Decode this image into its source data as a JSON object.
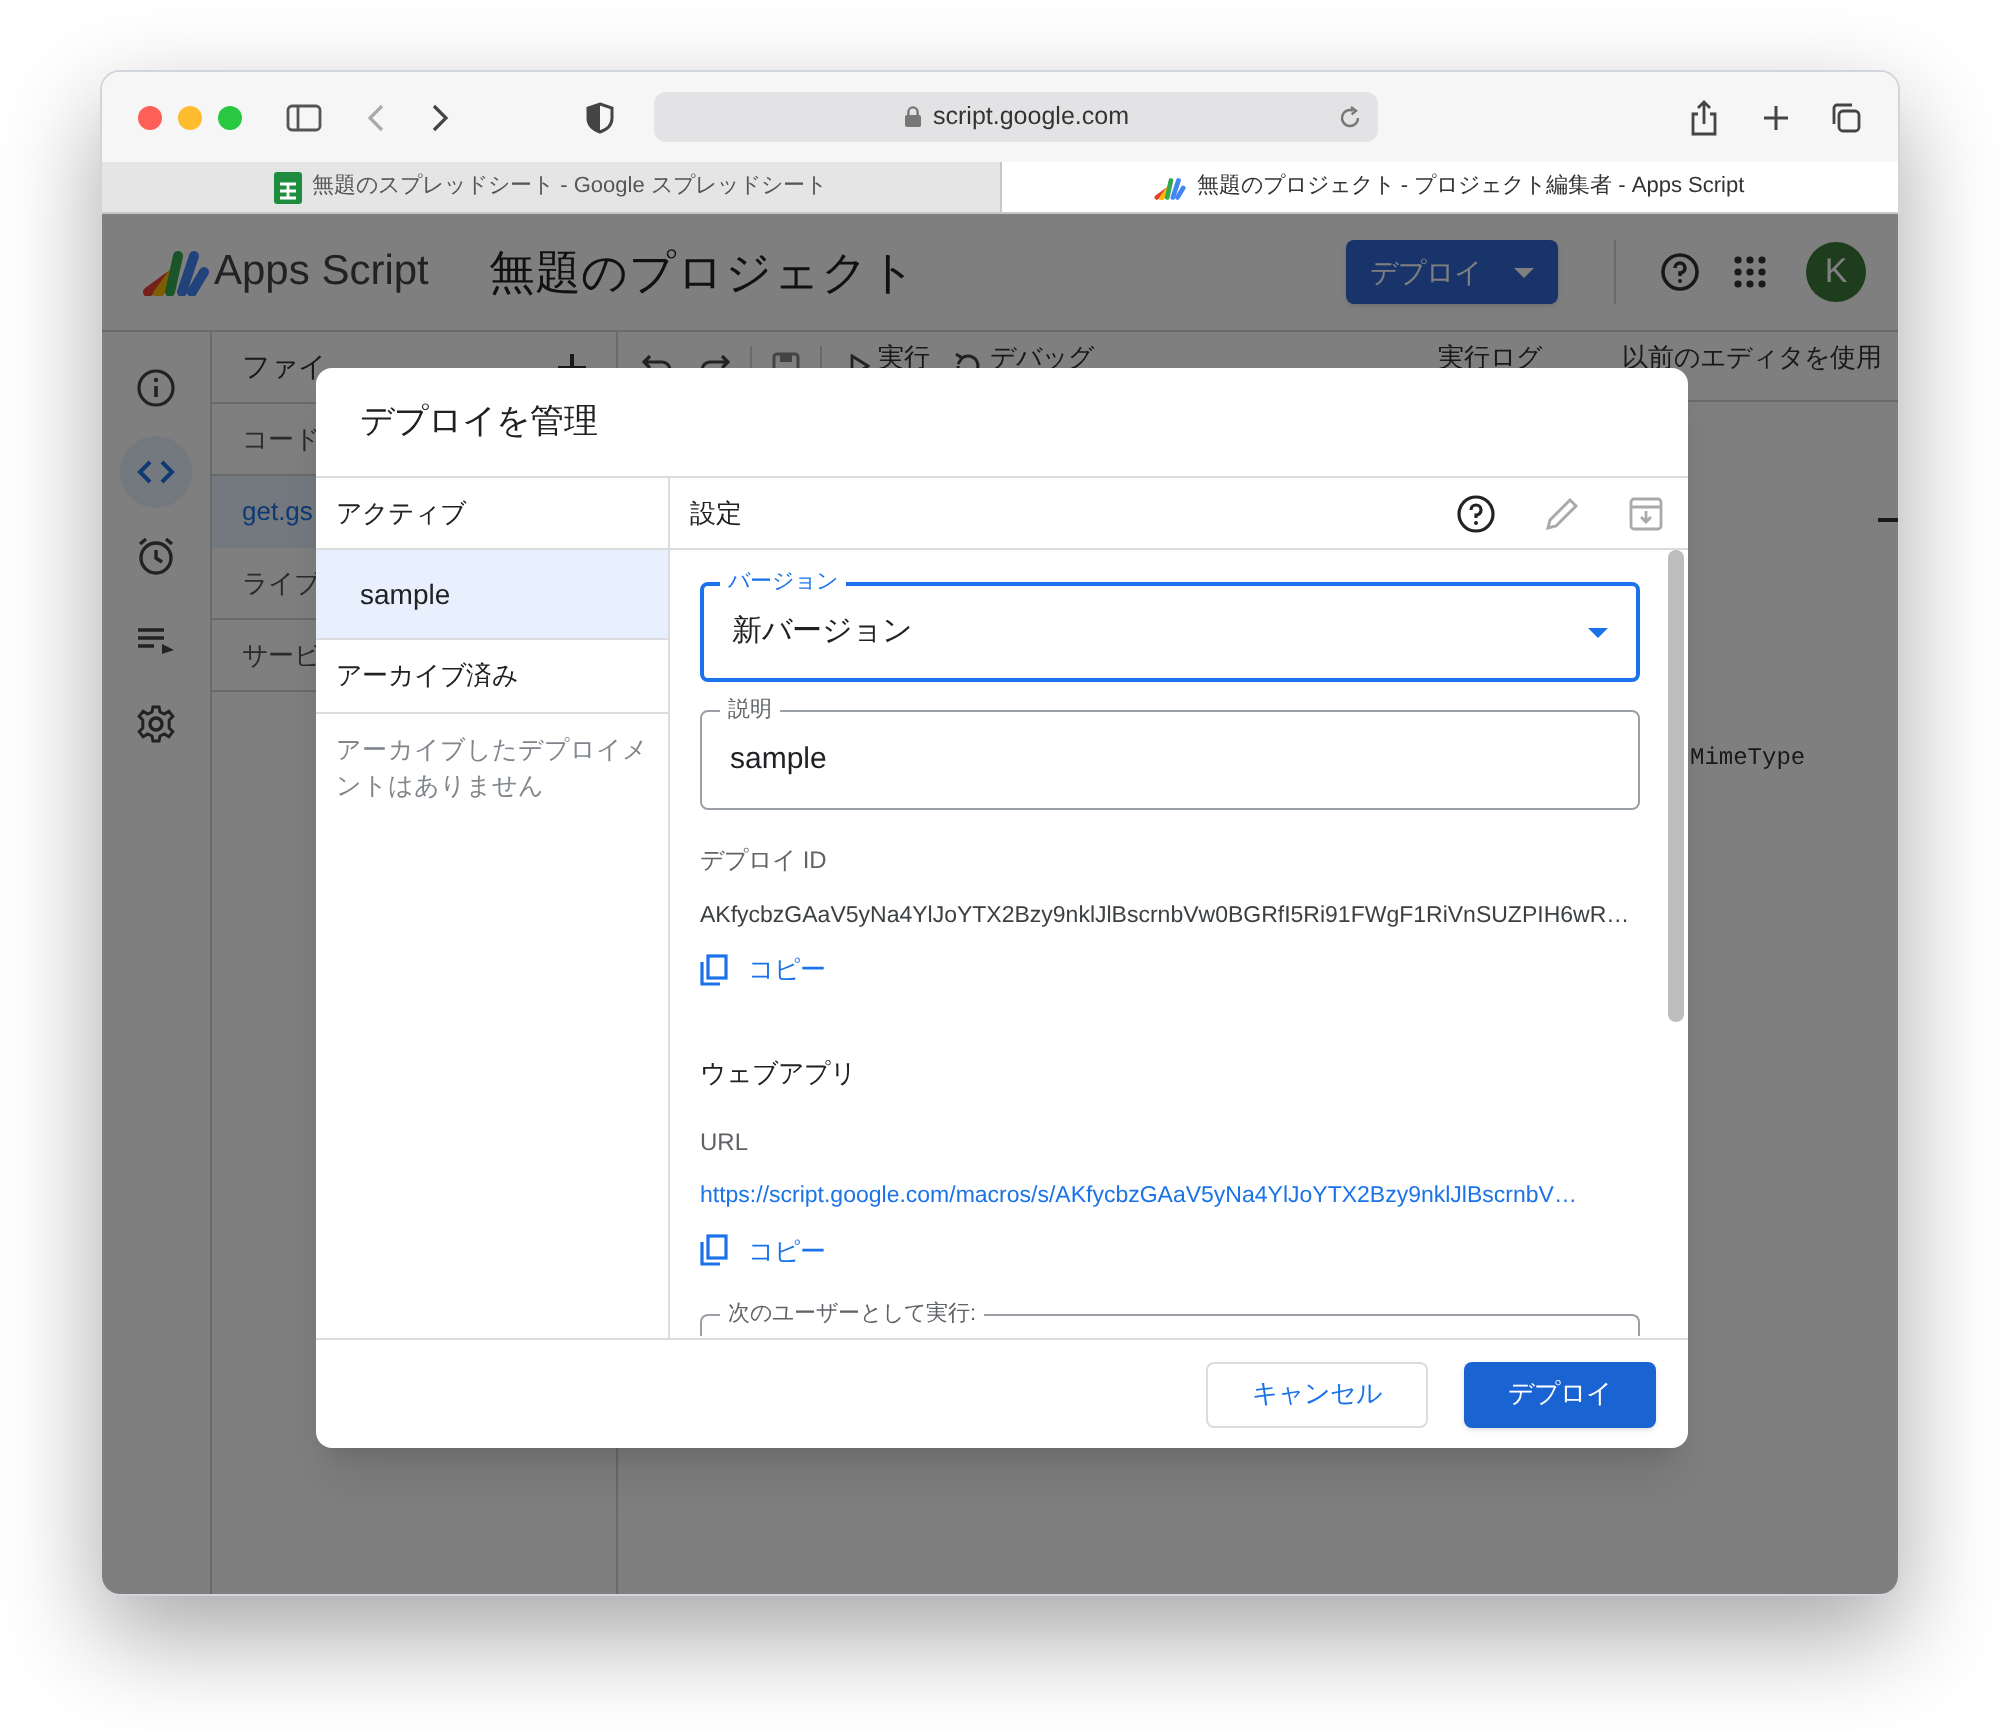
{
  "browser": {
    "url": "script.google.com",
    "tabs": [
      {
        "title": "無題のスプレッドシート - Google スプレッドシート",
        "selected": false,
        "kind": "sheets"
      },
      {
        "title": "無題のプロジェクト - プロジェクト編集者 - Apps Script",
        "selected": true,
        "kind": "script"
      }
    ]
  },
  "app": {
    "product": "Apps Script",
    "project": "無題のプロジェクト",
    "deploy_button": "デプロイ",
    "avatar": "K",
    "rail": [
      {
        "kind": "info",
        "selected": false
      },
      {
        "kind": "code",
        "selected": true
      },
      {
        "kind": "clock",
        "selected": false
      },
      {
        "kind": "list",
        "selected": false
      },
      {
        "kind": "gear",
        "selected": false
      }
    ],
    "files_panel": {
      "title": "ファイ",
      "items": [
        {
          "label": "コード",
          "selected": false,
          "kind": "heading"
        },
        {
          "label": "get.gs",
          "selected": true,
          "kind": "file"
        },
        {
          "label": "ライブ",
          "selected": false,
          "kind": "heading"
        },
        {
          "label": "サービ",
          "selected": false,
          "kind": "heading"
        }
      ]
    },
    "toolbar": {
      "run": "実行",
      "debug": "デバッグ",
      "log": "実行ログ",
      "legacy": "以前のエディタを使用"
    },
    "editor": {
      "code_fragment": "MimeType"
    }
  },
  "dialog": {
    "title": "デプロイを管理",
    "left": {
      "active_heading": "アクティブ",
      "deployments": [
        {
          "label": "sample",
          "selected": true
        }
      ],
      "archived_heading": "アーカイブ済み",
      "archived_empty": "アーカイブしたデプロイメントはありません"
    },
    "right": {
      "heading": "設定",
      "fields": [
        {
          "label": "バージョン",
          "value": "新バージョン",
          "focused": true,
          "kind": "select"
        },
        {
          "label": "説明",
          "value": "sample",
          "focused": false,
          "kind": "text"
        }
      ],
      "deploy_id_label": "デプロイ ID",
      "deploy_id": "AKfycbzGAaV5yNa4YlJoYTX2Bzy9nklJlBscrnbVw0BGRfI5Ri91FWgF1RiVnSUZPIH6wR…",
      "copy_1": "コピー",
      "web_app_heading": "ウェブアプリ",
      "url_label": "URL",
      "url": "https://script.google.com/macros/s/AKfycbzGAaV5yNa4YlJoYTX2Bzy9nklJlBscrnbV…",
      "copy_2": "コピー",
      "run_as_label": "次のユーザーとして実行:"
    },
    "buttons": [
      {
        "label": "キャンセル",
        "kind": "secondary"
      },
      {
        "label": "デプロイ",
        "kind": "primary"
      }
    ]
  }
}
